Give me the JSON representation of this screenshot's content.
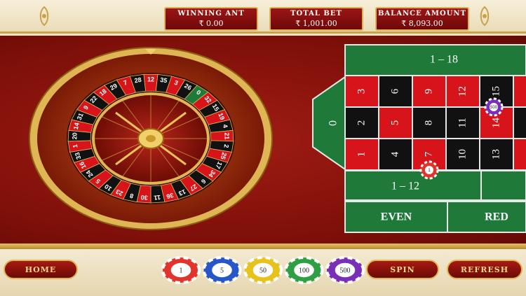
{
  "header": {
    "winning_amount_label": "WINNING ANT",
    "winning_amount_value": "₹ 0.00",
    "total_bet_label": "TOTAL BET",
    "total_bet_value": "₹ 1,001.00",
    "balance_label": "BALANCE AMOUNT",
    "balance_value": "₹ 8,093.00"
  },
  "wheel": {
    "numbers": [
      "0",
      "32",
      "15",
      "19",
      "4",
      "21",
      "2",
      "25",
      "17",
      "34",
      "6",
      "27",
      "13",
      "36",
      "11",
      "30",
      "8",
      "23",
      "10",
      "5",
      "24",
      "16",
      "33",
      "1",
      "20",
      "14",
      "31",
      "9",
      "22",
      "18",
      "29",
      "7",
      "28",
      "12",
      "35",
      "3",
      "26"
    ]
  },
  "table": {
    "zero": "0",
    "rows": [
      [
        "3",
        "6",
        "9",
        "12",
        "15"
      ],
      [
        "2",
        "5",
        "8",
        "11",
        "14"
      ],
      [
        "1",
        "4",
        "7",
        "10",
        "13"
      ]
    ],
    "dozen_top": "1 – 18",
    "dozen_bottom": "1 – 12",
    "even": "EVEN",
    "red": "RED"
  },
  "chips": [
    {
      "value": "1",
      "color": "#e0342c"
    },
    {
      "value": "5",
      "color": "#2756c9"
    },
    {
      "value": "50",
      "color": "#e6c21b"
    },
    {
      "value": "100",
      "color": "#2ea043"
    },
    {
      "value": "500",
      "color": "#7a2fb8"
    }
  ],
  "placed_chips": [
    {
      "cell": "7",
      "value": "1"
    },
    {
      "cell": "15",
      "value": "500"
    }
  ],
  "buttons": {
    "home": "HOME",
    "spin": "SPIN",
    "refresh": "REFRESH"
  },
  "colors": {
    "red": "#d6141a",
    "black": "#111111",
    "green": "#1f7a3a",
    "gold": "#d9b25a"
  }
}
